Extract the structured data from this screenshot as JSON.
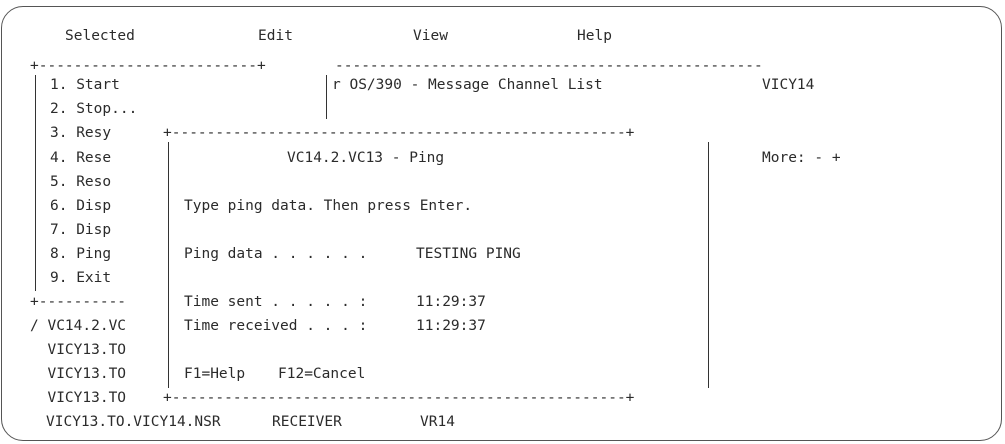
{
  "menubar": {
    "selected": "Selected",
    "edit": "Edit",
    "view": "View",
    "help": "Help"
  },
  "panel": {
    "title": "r OS/390 - Message Channel List",
    "qmgr": "VICY14",
    "more": "More: - +"
  },
  "dropdown": {
    "items": [
      "1. Start",
      "2. Stop...",
      "3. Resy",
      "4. Rese",
      "5. Reso",
      "6. Disp",
      "7. Disp",
      "8. Ping",
      "9. Exit"
    ]
  },
  "list": {
    "rows": [
      "/ VC14.2.VC",
      "  VICY13.TO",
      "  VICY13.TO",
      "  VICY13.TO"
    ],
    "last_row": {
      "name": "VICY13.TO.VICY14.NSR",
      "type": "RECEIVER",
      "disposition": "VR14"
    }
  },
  "dialog": {
    "title": "VC14.2.VC13 - Ping",
    "instruction": "Type ping data. Then press Enter.",
    "ping_label": "Ping data . . . . . .",
    "ping_value": "TESTING PING",
    "sent_label": "Time sent . . . . . :",
    "sent_value": "11:29:37",
    "received_label": "Time received . . . :",
    "received_value": "11:29:37",
    "f1": "F1=Help",
    "f12": "F12=Cancel"
  },
  "borders": {
    "menu_top_left": "+-------------------------+",
    "menu_top_right": "-------------------------------------------------",
    "menu_bottom": "+----------",
    "dialog_edge": "+----------------------------------------------------+"
  }
}
